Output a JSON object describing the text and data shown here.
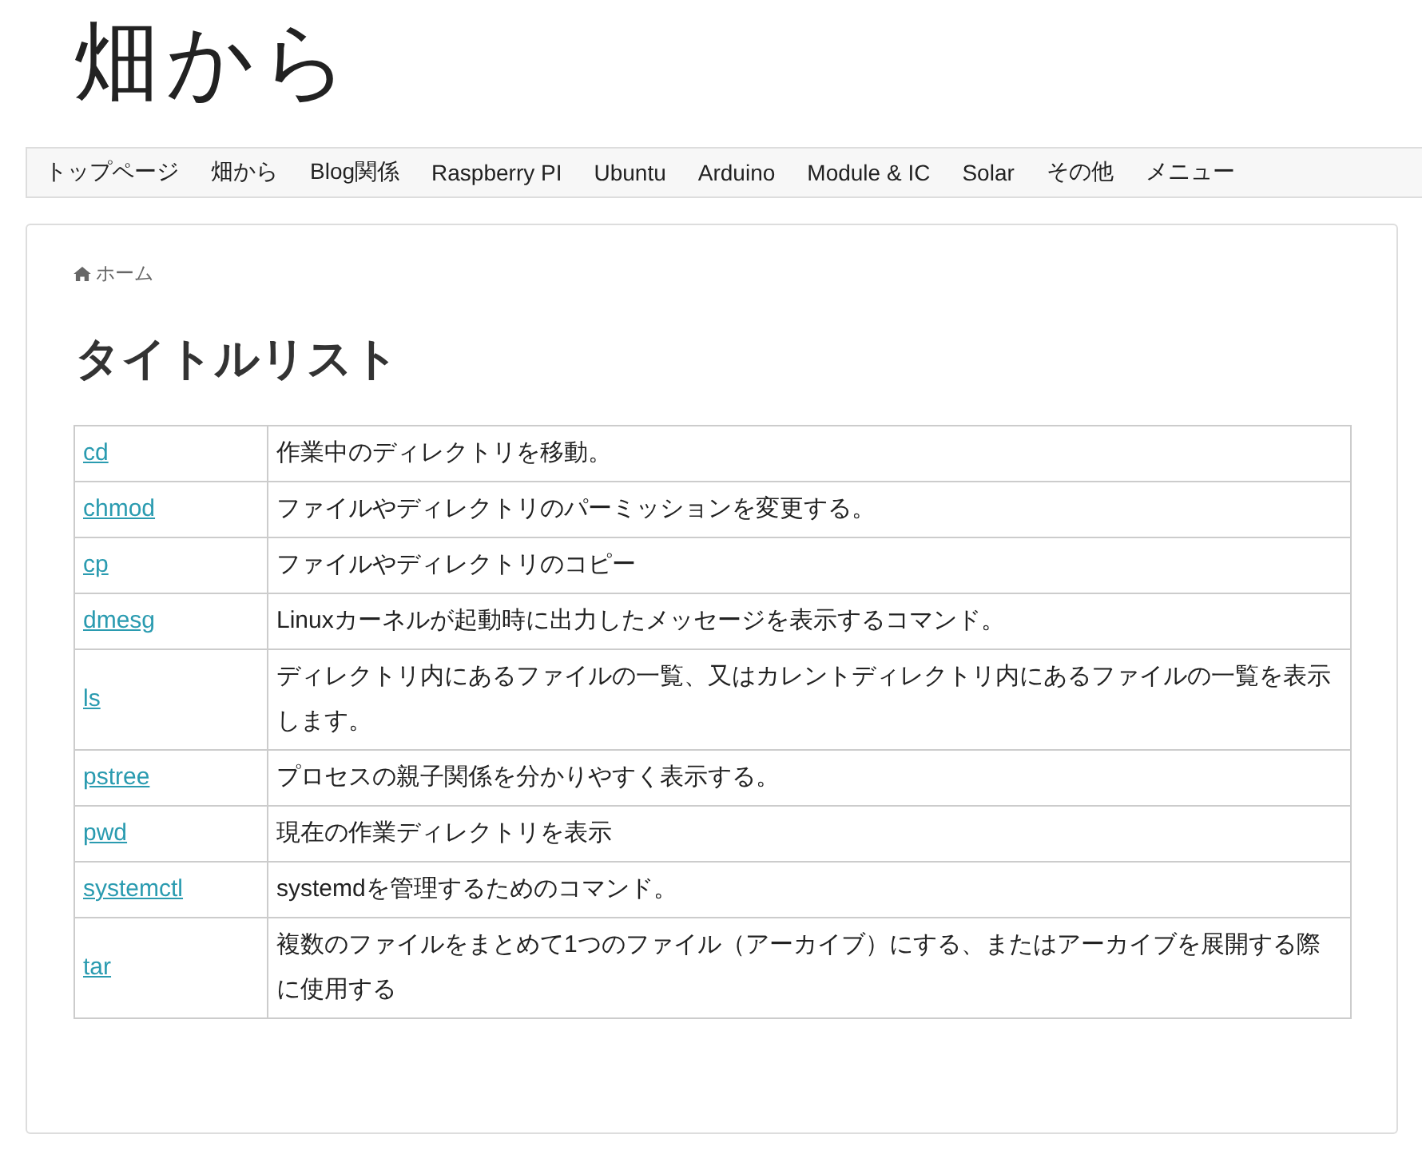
{
  "site_logo": "畑から",
  "nav": [
    "トップページ",
    "畑から",
    "Blog関係",
    "Raspberry PI",
    "Ubuntu",
    "Arduino",
    "Module & IC",
    "Solar",
    "その他",
    "メニュー"
  ],
  "breadcrumb": {
    "label": "ホーム"
  },
  "title": "タイトルリスト",
  "table": {
    "rows": [
      {
        "command": "cd",
        "description": "作業中のディレクトリを移動。"
      },
      {
        "command": "chmod",
        "description": "ファイルやディレクトリのパーミッションを変更する。"
      },
      {
        "command": "cp",
        "description": "ファイルやディレクトリのコピー"
      },
      {
        "command": "dmesg",
        "description": "Linuxカーネルが起動時に出力したメッセージを表示するコマンド。"
      },
      {
        "command": "ls",
        "description": "ディレクトリ内にあるファイルの一覧、又はカレントディレクトリ内にあるファイルの一覧を表示します。"
      },
      {
        "command": "pstree",
        "description": "プロセスの親子関係を分かりやすく表示する。"
      },
      {
        "command": "pwd",
        "description": "現在の作業ディレクトリを表示"
      },
      {
        "command": "systemctl",
        "description": "systemdを管理するためのコマンド。"
      },
      {
        "command": "tar",
        "description": "複数のファイルをまとめて1つのファイル（アーカイブ）にする、またはアーカイブを展開する際に使用する"
      }
    ]
  }
}
